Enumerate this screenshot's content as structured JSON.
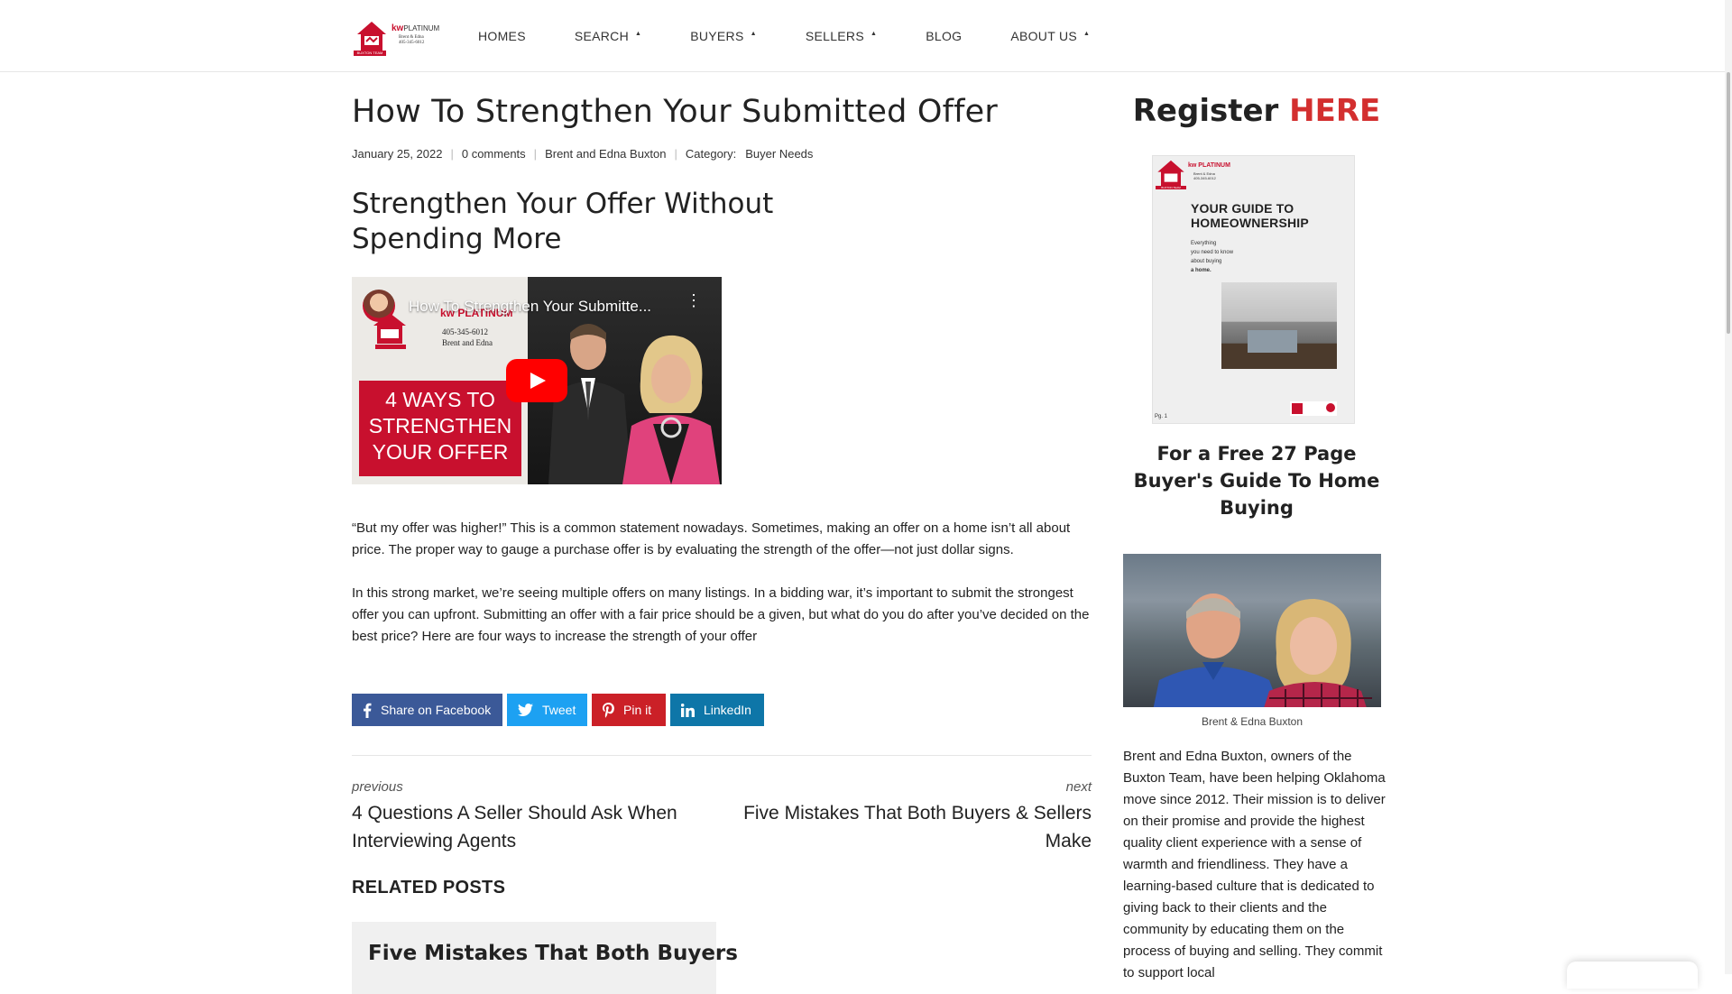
{
  "header": {
    "logo": {
      "brand": "kw",
      "brand_suffix": "PLATINUM",
      "names": "Brent & Edna",
      "phone": "405-345-6012",
      "team": "BUXTON TEAM"
    },
    "nav": [
      {
        "label": "HOMES",
        "has_caret": false
      },
      {
        "label": "SEARCH",
        "has_caret": true
      },
      {
        "label": "BUYERS",
        "has_caret": true
      },
      {
        "label": "SELLERS",
        "has_caret": true
      },
      {
        "label": "BLOG",
        "has_caret": false
      },
      {
        "label": "ABOUT US",
        "has_caret": true
      }
    ],
    "caret_glyph": "▲"
  },
  "post": {
    "title": "How To Strengthen Your Submitted Offer",
    "date": "January 25, 2022",
    "comments": "0 comments",
    "author": "Brent and Edna Buxton",
    "category_label": "Category:",
    "category": "Buyer Needs",
    "subheading": "Strengthen Your Offer Without Spending More",
    "video": {
      "title": "How To Strengthen Your Submitte...",
      "badge": "4 WAYS TO STRENGTHEN YOUR OFFER",
      "kw_text": "kw PLATINUM",
      "phone": "405-345-6012",
      "names": "Brent and Edna",
      "team": "BUXTON TEAM"
    },
    "paragraph_1": "“But my offer was higher!” This is a common statement nowadays. Sometimes, making an offer on a home isn’t all about price. The proper way to gauge a purchase offer is by evaluating the strength of the offer—not just dollar signs.",
    "paragraph_2": "In this strong market, we’re seeing multiple offers on many listings. In a bidding war, it’s important to submit the strongest offer you can upfront. Submitting an offer with a fair price should be a given, but what do you do after you’ve decided on the best price? Here are four ways to increase the strength of your offer"
  },
  "share": {
    "facebook": "Share on Facebook",
    "twitter": "Tweet",
    "pinterest": "Pin it",
    "linkedin": "LinkedIn",
    "colors": {
      "facebook": "#3b5998",
      "twitter": "#1da1f2",
      "pinterest": "#cb2027",
      "linkedin": "#0e76a8"
    }
  },
  "post_nav": {
    "previous_label": "previous",
    "previous_title": "4 Questions A Seller Should Ask When Interviewing Agents",
    "next_label": "next",
    "next_title": "Five Mistakes That Both Buyers & Sellers Make"
  },
  "related": {
    "heading": "RELATED POSTS",
    "cards": [
      {
        "title": "Five Mistakes That Both Buyers"
      }
    ]
  },
  "sidebar": {
    "register_prefix": "Register ",
    "register_highlight": "HERE",
    "register_color": "#d32f2f",
    "guide": {
      "title_line1": "YOUR GUIDE TO",
      "title_line2": "HOMEOWNERSHIP",
      "sub_lines": [
        "Everything",
        "you need to know",
        "about buying",
        "a home."
      ],
      "page": "Pg. 1",
      "kw": "kw PLATINUM",
      "names": "Brent & Edna",
      "phone": "405-345-6012",
      "team": "BUXTON TEAM"
    },
    "free_guide": "For a Free 27 Page Buyer's Guide To Home Buying",
    "caption": "Brent & Edna Buxton",
    "bio": "Brent and Edna Buxton, owners of the Buxton Team, have been helping Oklahoma move since 2012. Their mission is to deliver on their promise and provide the highest quality client experience with a sense of warmth and friendliness. They have a learning-based culture that is dedicated to giving back to their clients and the community by educating them on the process of buying and selling. They commit to support local"
  }
}
